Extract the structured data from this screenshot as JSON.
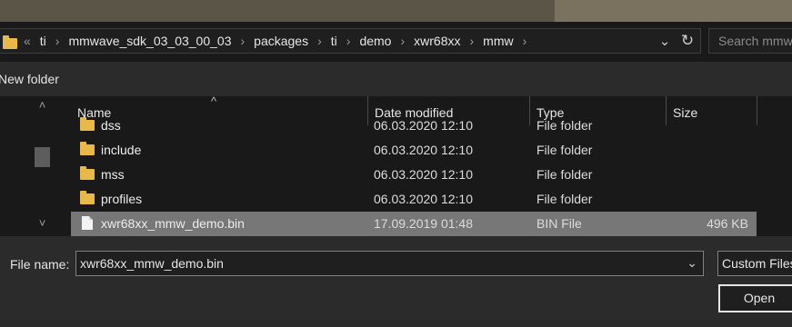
{
  "breadcrumbs": {
    "overflow": "«",
    "items": [
      "ti",
      "mmwave_sdk_03_03_00_03",
      "packages",
      "ti",
      "demo",
      "xwr68xx",
      "mmw"
    ]
  },
  "search": {
    "placeholder": "Search mmw"
  },
  "toolbar": {
    "new_folder_label": "New folder"
  },
  "columns": {
    "name": "Name",
    "date": "Date modified",
    "type": "Type",
    "size": "Size"
  },
  "files": [
    {
      "name": "dss",
      "date": "06.03.2020 12:10",
      "type": "File folder",
      "size": "",
      "icon": "folder-icon"
    },
    {
      "name": "include",
      "date": "06.03.2020 12:10",
      "type": "File folder",
      "size": "",
      "icon": "folder-icon"
    },
    {
      "name": "mss",
      "date": "06.03.2020 12:10",
      "type": "File folder",
      "size": "",
      "icon": "folder-icon"
    },
    {
      "name": "profiles",
      "date": "06.03.2020 12:10",
      "type": "File folder",
      "size": "",
      "icon": "folder-icon"
    },
    {
      "name": "xwr68xx_mmw_demo.bin",
      "date": "17.09.2019 01:48",
      "type": "BIN File",
      "size": "496 KB",
      "icon": "file-icon",
      "selected": true
    }
  ],
  "footer": {
    "file_name_label": "File name:",
    "file_name_value": "xwr68xx_mmw_demo.bin",
    "file_type_value": "Custom Files",
    "open_label": "Open"
  },
  "colors": {
    "background": "#191919",
    "toolbar": "#2b2b2b",
    "selection": "#777777",
    "folder": "#e8b949"
  }
}
